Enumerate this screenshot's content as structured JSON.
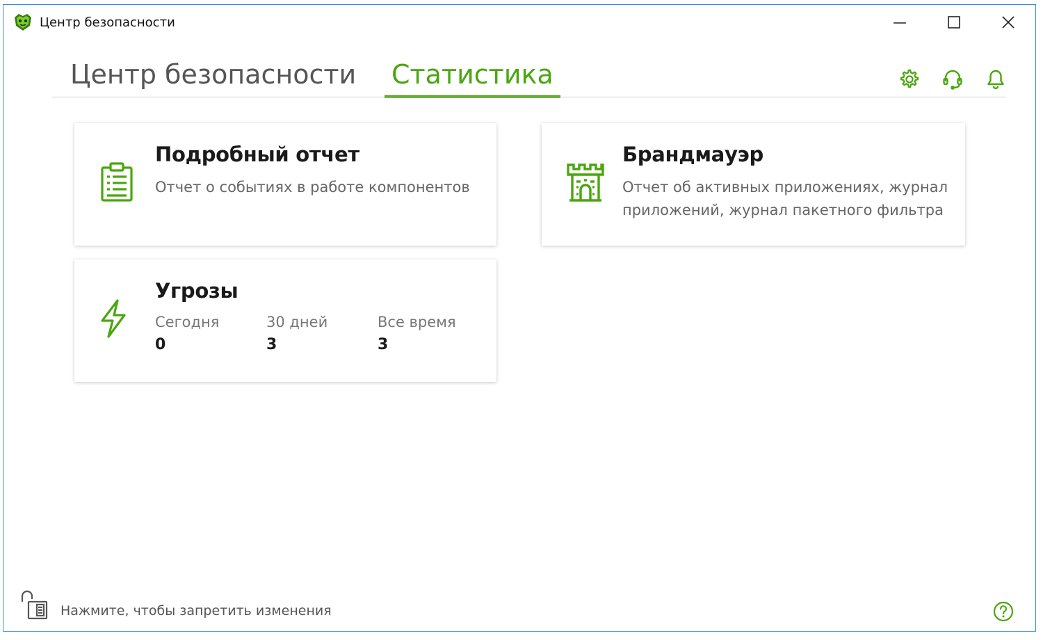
{
  "window": {
    "title": "Центр безопасности"
  },
  "tabs": [
    {
      "label": "Центр безопасности",
      "active": false
    },
    {
      "label": "Статистика",
      "active": true
    }
  ],
  "header_icons": [
    "gear-icon",
    "support-headset-icon",
    "bell-icon"
  ],
  "cards": {
    "report": {
      "title": "Подробный отчет",
      "description": "Отчет о событиях в работе компонентов",
      "icon": "clipboard-list-icon"
    },
    "firewall": {
      "title": "Брандмауэр",
      "description_line1": "Отчет об активных приложениях, журнал",
      "description_line2": "приложений, журнал пакетного фильтра",
      "icon": "castle-firewall-icon"
    },
    "threats": {
      "title": "Угрозы",
      "icon": "lightning-icon",
      "stats": [
        {
          "label": "Сегодня",
          "value": "0"
        },
        {
          "label": "30 дней",
          "value": "3"
        },
        {
          "label": "Все время",
          "value": "3"
        }
      ]
    }
  },
  "footer": {
    "lock_text": "Нажмите, чтобы запретить изменения",
    "lock_icon": "unlocked-padlock-icon",
    "help_icon": "help-circle-icon"
  },
  "colors": {
    "accent": "#4aa60f",
    "window_border": "#2f8de4"
  }
}
